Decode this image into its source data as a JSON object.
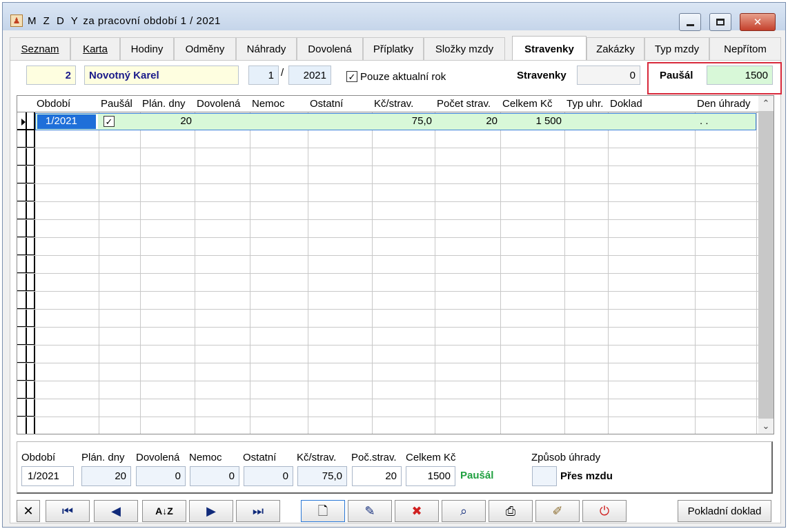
{
  "window": {
    "title_main": "M Z D Y",
    "title_rest": "za pracovní období  1 / 2021"
  },
  "tabs": [
    {
      "label": "Seznam",
      "active": false
    },
    {
      "label": "Karta",
      "active": false
    },
    {
      "label": "Hodiny",
      "active": false
    },
    {
      "label": "Odměny",
      "active": false
    },
    {
      "label": "Náhrady",
      "active": false
    },
    {
      "label": "Dovolená",
      "active": false
    },
    {
      "label": "Příplatky",
      "active": false
    },
    {
      "label": "Složky mzdy",
      "active": false
    },
    {
      "label": "Stravenky",
      "active": true
    },
    {
      "label": "Zakázky",
      "active": false
    },
    {
      "label": "Typ mzdy",
      "active": false
    },
    {
      "label": "Nepřítom",
      "active": false
    }
  ],
  "header": {
    "employee_number": "2",
    "employee_name": "Novotný Karel",
    "month": "1",
    "slash": "/",
    "year": "2021",
    "current_year_only_label": "Pouze aktualní rok",
    "current_year_only_checked": true,
    "stravenky_label": "Stravenky",
    "stravenky_value": "0",
    "pausal_label": "Paušál",
    "pausal_value": "1500"
  },
  "grid": {
    "columns": [
      "Období",
      "Paušál",
      "Plán. dny",
      "Dovolená",
      "Nemoc",
      "Ostatní",
      "Kč/strav.",
      "Počet strav.",
      "Celkem Kč",
      "Typ uhr.",
      "Doklad",
      "Den úhrady"
    ],
    "rows": [
      {
        "obdobi": "1/2021",
        "pausal_checked": true,
        "plan_dny": "20",
        "dovolena": "",
        "nemoc": "",
        "ostatni": "",
        "kc_strav": "75,0",
        "pocet_strav": "20",
        "celkem_kc": "1 500",
        "typ_uhr": "",
        "doklad": "",
        "den_uhrady": ". ."
      }
    ]
  },
  "detail": {
    "labels": {
      "obdobi": "Období",
      "plan_dny": "Plán. dny",
      "dovolena": "Dovolená",
      "nemoc": "Nemoc",
      "ostatni": "Ostatní",
      "kc_strav": "Kč/strav.",
      "poc_strav": "Poč.strav.",
      "celkem_kc": "Celkem Kč",
      "zpusob_uhrady": "Způsob úhrady"
    },
    "values": {
      "obdobi": "1/2021",
      "plan_dny": "20",
      "dovolena": "0",
      "nemoc": "0",
      "ostatni": "0",
      "kc_strav": "75,0",
      "poc_strav": "20",
      "celkem_kc": "1500",
      "pausal_tag": "Paušál",
      "zpusob_uhrady": "",
      "zpusob_uhrady_text": "Přes mzdu"
    }
  },
  "toolbar": {
    "pokladni_doklad_label": "Pokladní doklad",
    "icons": [
      "cancel-icon",
      "first-record-icon",
      "previous-record-icon",
      "sort-az-icon",
      "next-record-icon",
      "last-record-icon",
      "new-document-icon",
      "edit-record-icon",
      "delete-record-icon",
      "find-icon",
      "print-icon",
      "tools-icon",
      "power-icon"
    ]
  },
  "colors": {
    "selected_row_bg": "#d8f8d8",
    "selection_blue": "#1e6fd9",
    "highlight_red": "#d8283a",
    "pausal_green": "#20a040",
    "name_navy": "#1a1a8a"
  }
}
